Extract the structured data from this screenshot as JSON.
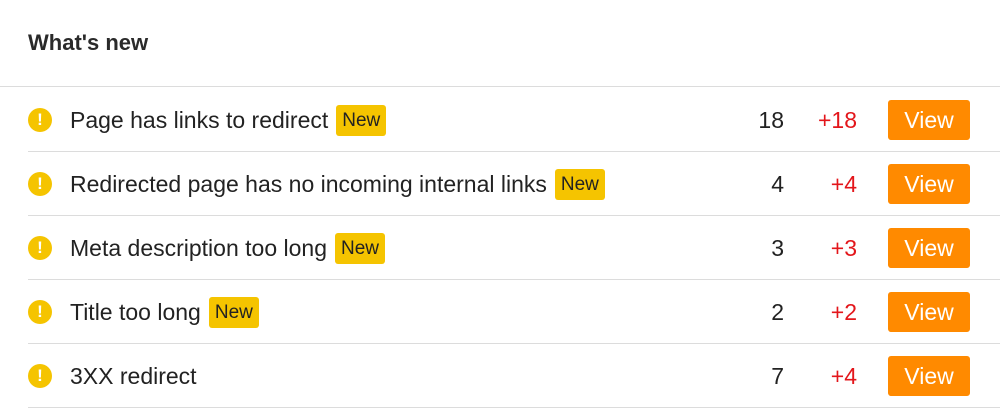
{
  "panel": {
    "title": "What's new"
  },
  "issues": [
    {
      "icon": "warning-icon",
      "name": "Page has links to redirect",
      "badge": "New",
      "count": "18",
      "delta": "+18",
      "action": "View"
    },
    {
      "icon": "warning-icon",
      "name": "Redirected page has no incoming internal links",
      "badge": "New",
      "count": "4",
      "delta": "+4",
      "action": "View"
    },
    {
      "icon": "warning-icon",
      "name": "Meta description too long",
      "badge": "New",
      "count": "3",
      "delta": "+3",
      "action": "View"
    },
    {
      "icon": "warning-icon",
      "name": "Title too long",
      "badge": "New",
      "count": "2",
      "delta": "+2",
      "action": "View"
    },
    {
      "icon": "warning-icon",
      "name": "3XX redirect",
      "badge": "",
      "count": "7",
      "delta": "+4",
      "action": "View"
    }
  ],
  "colors": {
    "warning": "#f5c400",
    "badge": "#f5c400",
    "delta": "#e3161b",
    "button": "#ff8a00",
    "divider": "#dcdcdc"
  }
}
